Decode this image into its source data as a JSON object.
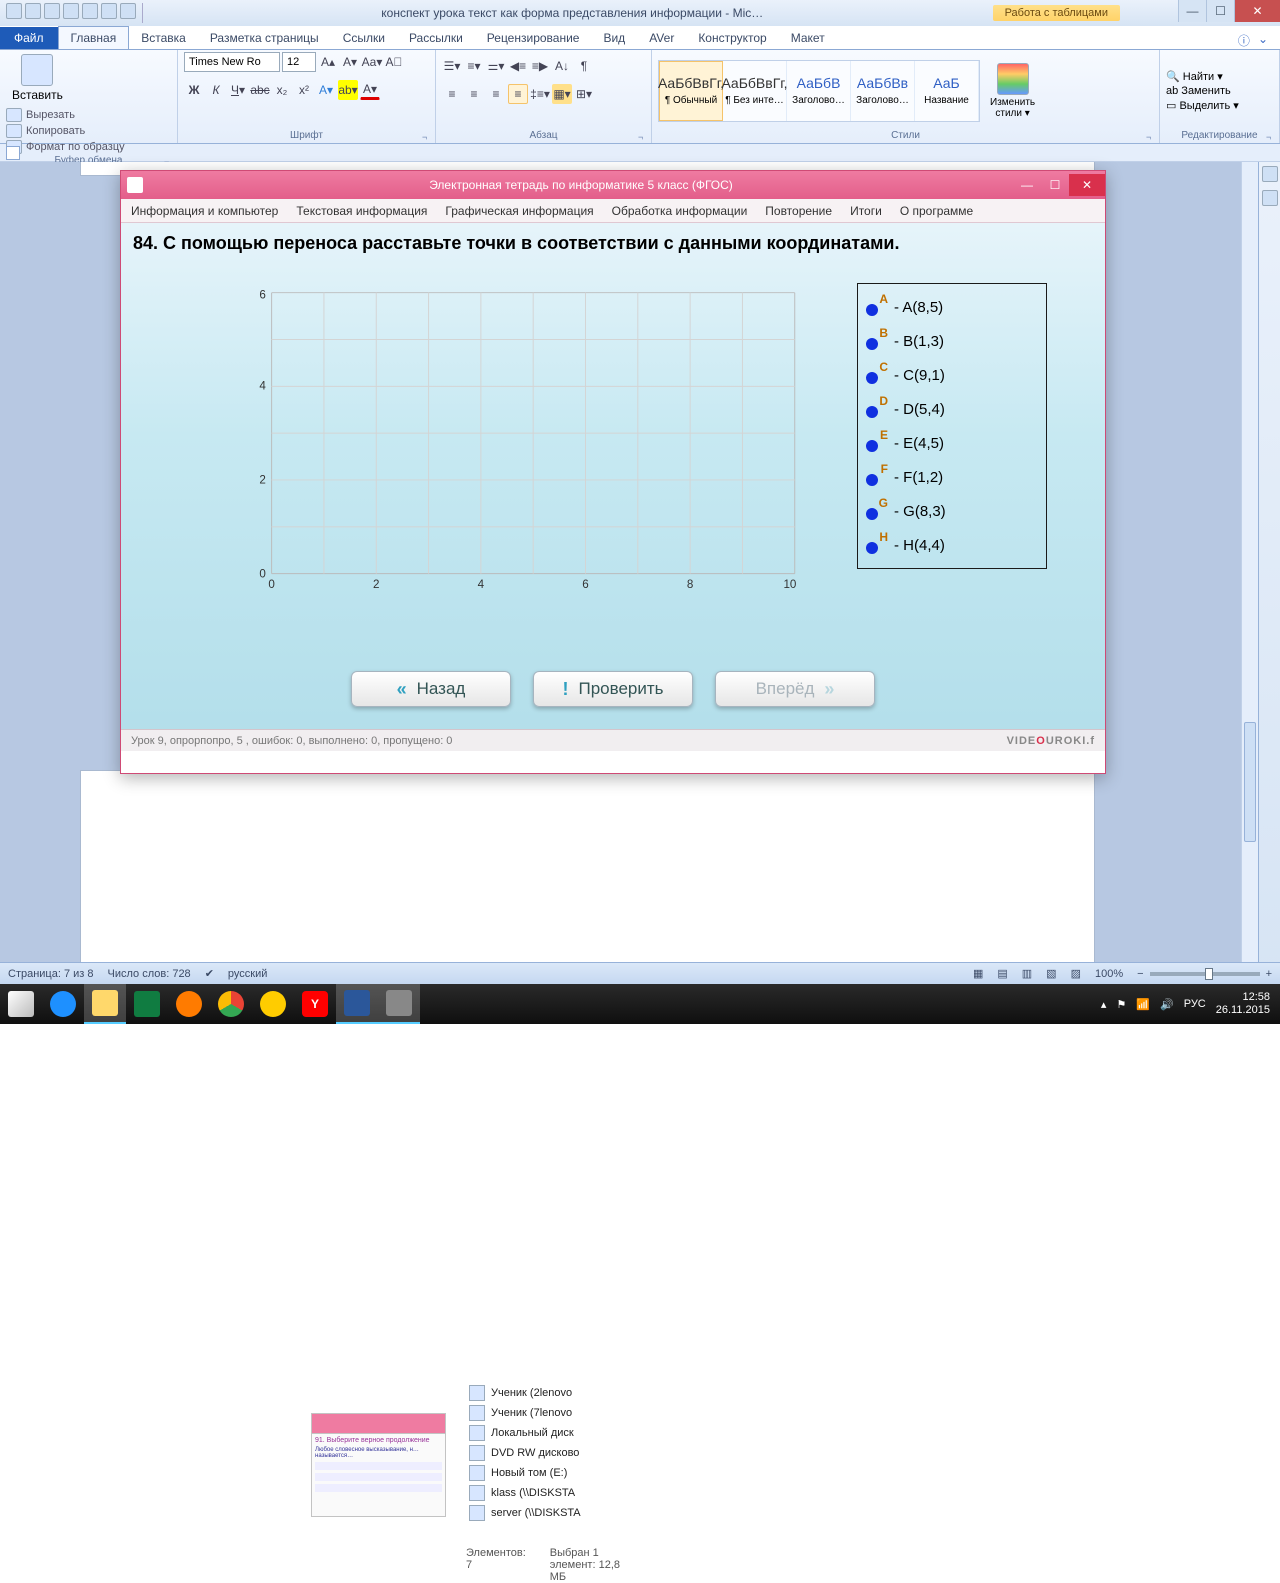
{
  "word": {
    "title": "конспект урока текст как форма представления информации  -  Mic…",
    "tools_tab": "Работа с таблицами",
    "ribbon_tabs": [
      "Главная",
      "Вставка",
      "Разметка страницы",
      "Ссылки",
      "Рассылки",
      "Рецензирование",
      "Вид",
      "AVer",
      "Конструктор",
      "Макет"
    ],
    "file": "Файл",
    "clipboard": {
      "paste": "Вставить",
      "cut": "Вырезать",
      "copy": "Копировать",
      "fmt": "Формат по образцу",
      "label": "Буфер обмена"
    },
    "font": {
      "name": "Times New Ro",
      "size": "12",
      "label": "Шрифт"
    },
    "paragraph_label": "Абзац",
    "styles": {
      "label": "Стили",
      "change": "Изменить\nстили ▾",
      "items": [
        {
          "prev": "АаБбВвГг,",
          "name": "¶ Обычный",
          "sel": true
        },
        {
          "prev": "АаБбВвГг,",
          "name": "¶ Без инте…"
        },
        {
          "prev": "АаБбВ",
          "name": "Заголово…",
          "blue": true
        },
        {
          "prev": "АаБбВв",
          "name": "Заголово…",
          "blue": true
        },
        {
          "prev": "АаБ",
          "name": "Название",
          "blue": true
        }
      ]
    },
    "editing": {
      "label": "Редактирование",
      "find": "Найти ▾",
      "replace": "Заменить",
      "select": "Выделить ▾"
    },
    "status": {
      "page": "Страница: 7 из 8",
      "words": "Число слов: 728",
      "lang": "русский",
      "zoom": "100%"
    }
  },
  "app": {
    "title": "Электронная тетрадь по информатике 5 класс (ФГОС)",
    "menu": [
      "Информация и компьютер",
      "Текстовая информация",
      "Графическая информация",
      "Обработка информации",
      "Повторение",
      "Итоги",
      "О программе"
    ],
    "task": "84. С помощью переноса расставьте точки в соответствии с данными координатами.",
    "axes": {
      "x_ticks": [
        "0",
        "2",
        "4",
        "6",
        "8",
        "10"
      ],
      "y_ticks": [
        "0",
        "2",
        "4",
        "6"
      ]
    },
    "points": [
      {
        "l": "A",
        "t": "- A(8,5)"
      },
      {
        "l": "B",
        "t": "- B(1,3)"
      },
      {
        "l": "C",
        "t": "- C(9,1)"
      },
      {
        "l": "D",
        "t": "- D(5,4)"
      },
      {
        "l": "E",
        "t": "- E(4,5)"
      },
      {
        "l": "F",
        "t": "- F(1,2)"
      },
      {
        "l": "G",
        "t": "- G(8,3)"
      },
      {
        "l": "H",
        "t": "- H(4,4)"
      }
    ],
    "back": "Назад",
    "check": "Проверить",
    "fwd": "Вперёд",
    "status": "Урок 9, опрорпопро, 5 ,  ошибок: 0,  выполнено: 0,  пропущено: 0",
    "brand_pre": "VIDE",
    "brand_o": "O",
    "brand_post": "UROKI.f"
  },
  "explorer": {
    "items": [
      "Ученик (2lenovo",
      "Ученик (7lenovo",
      "Локальный диск",
      "DVD RW дисково",
      "Новый том (E:)",
      "klass (\\\\DISKSTA",
      "server (\\\\DISKSTA"
    ],
    "status1": "Элементов: 7",
    "status2": "Выбран 1 элемент: 12,8 МБ",
    "thumb_title": "91. Выберите верное продолжение",
    "thumb_sub": "Любое словесное высказывание, н… называется…"
  },
  "taskbar": {
    "lang": "РУС",
    "time": "12:58",
    "date": "26.11.2015"
  }
}
